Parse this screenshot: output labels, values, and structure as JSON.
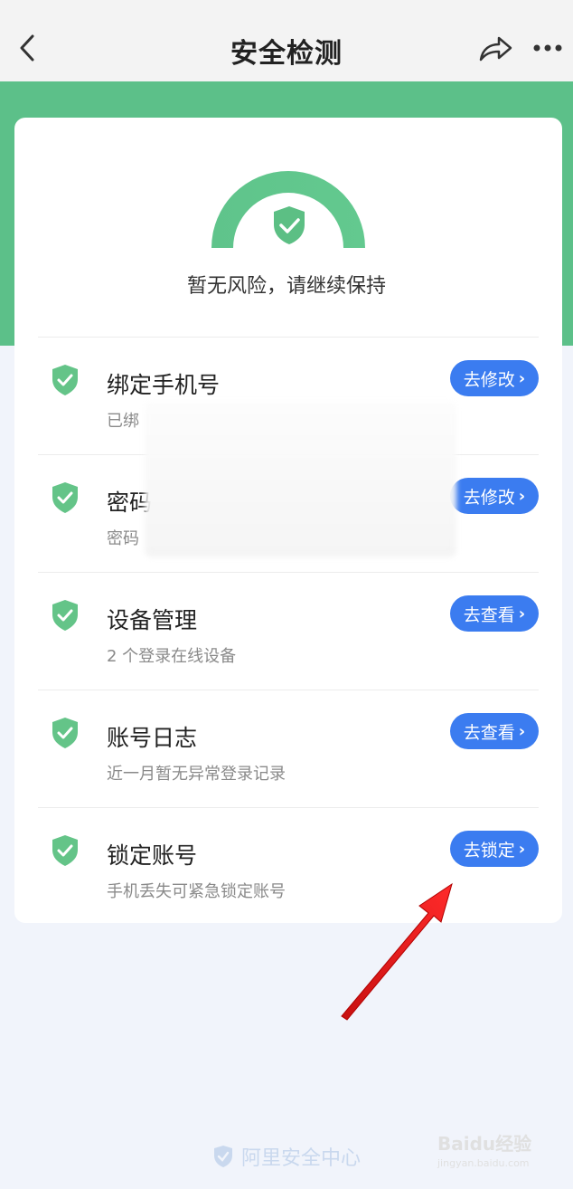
{
  "nav": {
    "title": "安全检测",
    "back_icon": "chevron-left-icon",
    "share_icon": "share-icon",
    "more_icon": "more-dots-icon"
  },
  "colors": {
    "green": "#5cc089",
    "button_blue": "#3b7cf0",
    "background": "#f1f4fb"
  },
  "summary": {
    "status_text": "暂无风险，请继续保持"
  },
  "items": [
    {
      "title": "绑定手机号",
      "subtitle": "已绑",
      "button": "去修改",
      "icon": "shield-check-icon"
    },
    {
      "title": "密码",
      "subtitle": "密码",
      "button": "去修改",
      "icon": "shield-check-icon"
    },
    {
      "title": "设备管理",
      "subtitle": "2 个登录在线设备",
      "button": "去查看",
      "icon": "shield-check-icon"
    },
    {
      "title": "账号日志",
      "subtitle": "近一月暂无异常登录记录",
      "button": "去查看",
      "icon": "shield-check-icon"
    },
    {
      "title": "锁定账号",
      "subtitle": "手机丢失可紧急锁定账号",
      "button": "去锁定",
      "icon": "shield-check-icon"
    }
  ],
  "footer": {
    "brand": "阿里安全中心"
  },
  "watermark": {
    "text": "Baidu经验",
    "sub": "jingyan.baidu.com"
  }
}
